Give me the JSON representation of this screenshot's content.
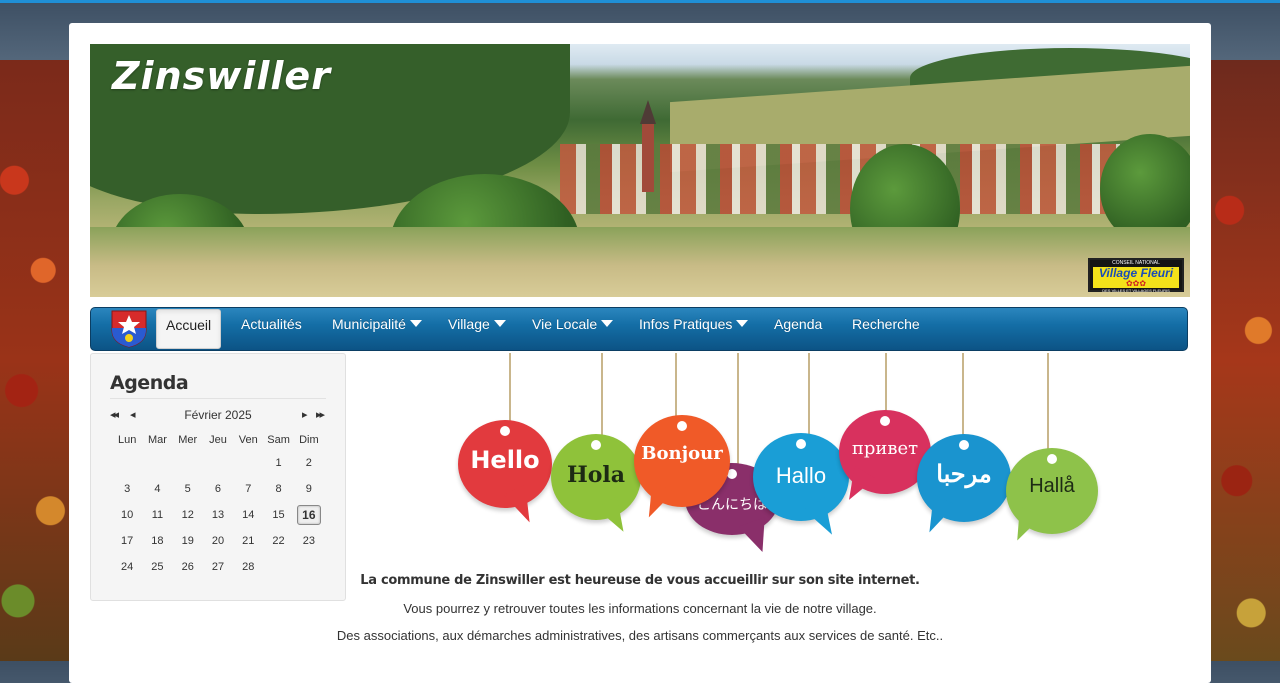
{
  "site": {
    "logo_text": "Zinswiller",
    "badge": {
      "top": "CONSEIL NATIONAL",
      "main": "Village Fleuri",
      "stars": "✿✿✿",
      "bottom": "DES VILLES ET VILLAGES FLEURIS"
    }
  },
  "nav": {
    "items": [
      {
        "label": "Accueil",
        "active": true,
        "dropdown": false
      },
      {
        "label": "Actualités",
        "active": false,
        "dropdown": false
      },
      {
        "label": "Municipalité",
        "active": false,
        "dropdown": true
      },
      {
        "label": "Village",
        "active": false,
        "dropdown": true
      },
      {
        "label": "Vie Locale",
        "active": false,
        "dropdown": true
      },
      {
        "label": "Infos Pratiques",
        "active": false,
        "dropdown": true
      },
      {
        "label": "Agenda",
        "active": false,
        "dropdown": false
      },
      {
        "label": "Recherche",
        "active": false,
        "dropdown": false
      }
    ]
  },
  "agenda": {
    "title": "Agenda",
    "month": "Février 2025",
    "nav": {
      "prev_year": "◂◂",
      "prev_month": "◂",
      "next_month": "▸",
      "next_year": "▸▸"
    },
    "weekdays": [
      "Lun",
      "Mar",
      "Mer",
      "Jeu",
      "Ven",
      "Sam",
      "Dim"
    ],
    "weeks": [
      [
        "",
        "",
        "",
        "",
        "",
        "1",
        "2"
      ],
      [
        "3",
        "4",
        "5",
        "6",
        "7",
        "8",
        "9"
      ],
      [
        "10",
        "11",
        "12",
        "13",
        "14",
        "15",
        "16"
      ],
      [
        "17",
        "18",
        "19",
        "20",
        "21",
        "22",
        "23"
      ],
      [
        "24",
        "25",
        "26",
        "27",
        "28",
        "",
        ""
      ]
    ],
    "today": "16"
  },
  "greetings": {
    "hello": "Hello",
    "hola": "Hola",
    "bonjour": "Bonjour",
    "konnichiwa": "こんにちは",
    "hallo": "Hallo",
    "privet": "привет",
    "marhaba": "مرحبا",
    "halla": "Hallå"
  },
  "welcome": {
    "line1": "La commune de Zinswiller est heureuse de vous accueillir sur son site internet.",
    "line2": "Vous pourrez y retrouver toutes les informations concernant la vie de notre village.",
    "line3": "Des associations, aux démarches administratives, des artisans commerçants aux services de santé. Etc.."
  },
  "colors": {
    "accent": "#1f8fd6",
    "nav_top": "#2b86be",
    "nav_bottom": "#0c5385"
  }
}
